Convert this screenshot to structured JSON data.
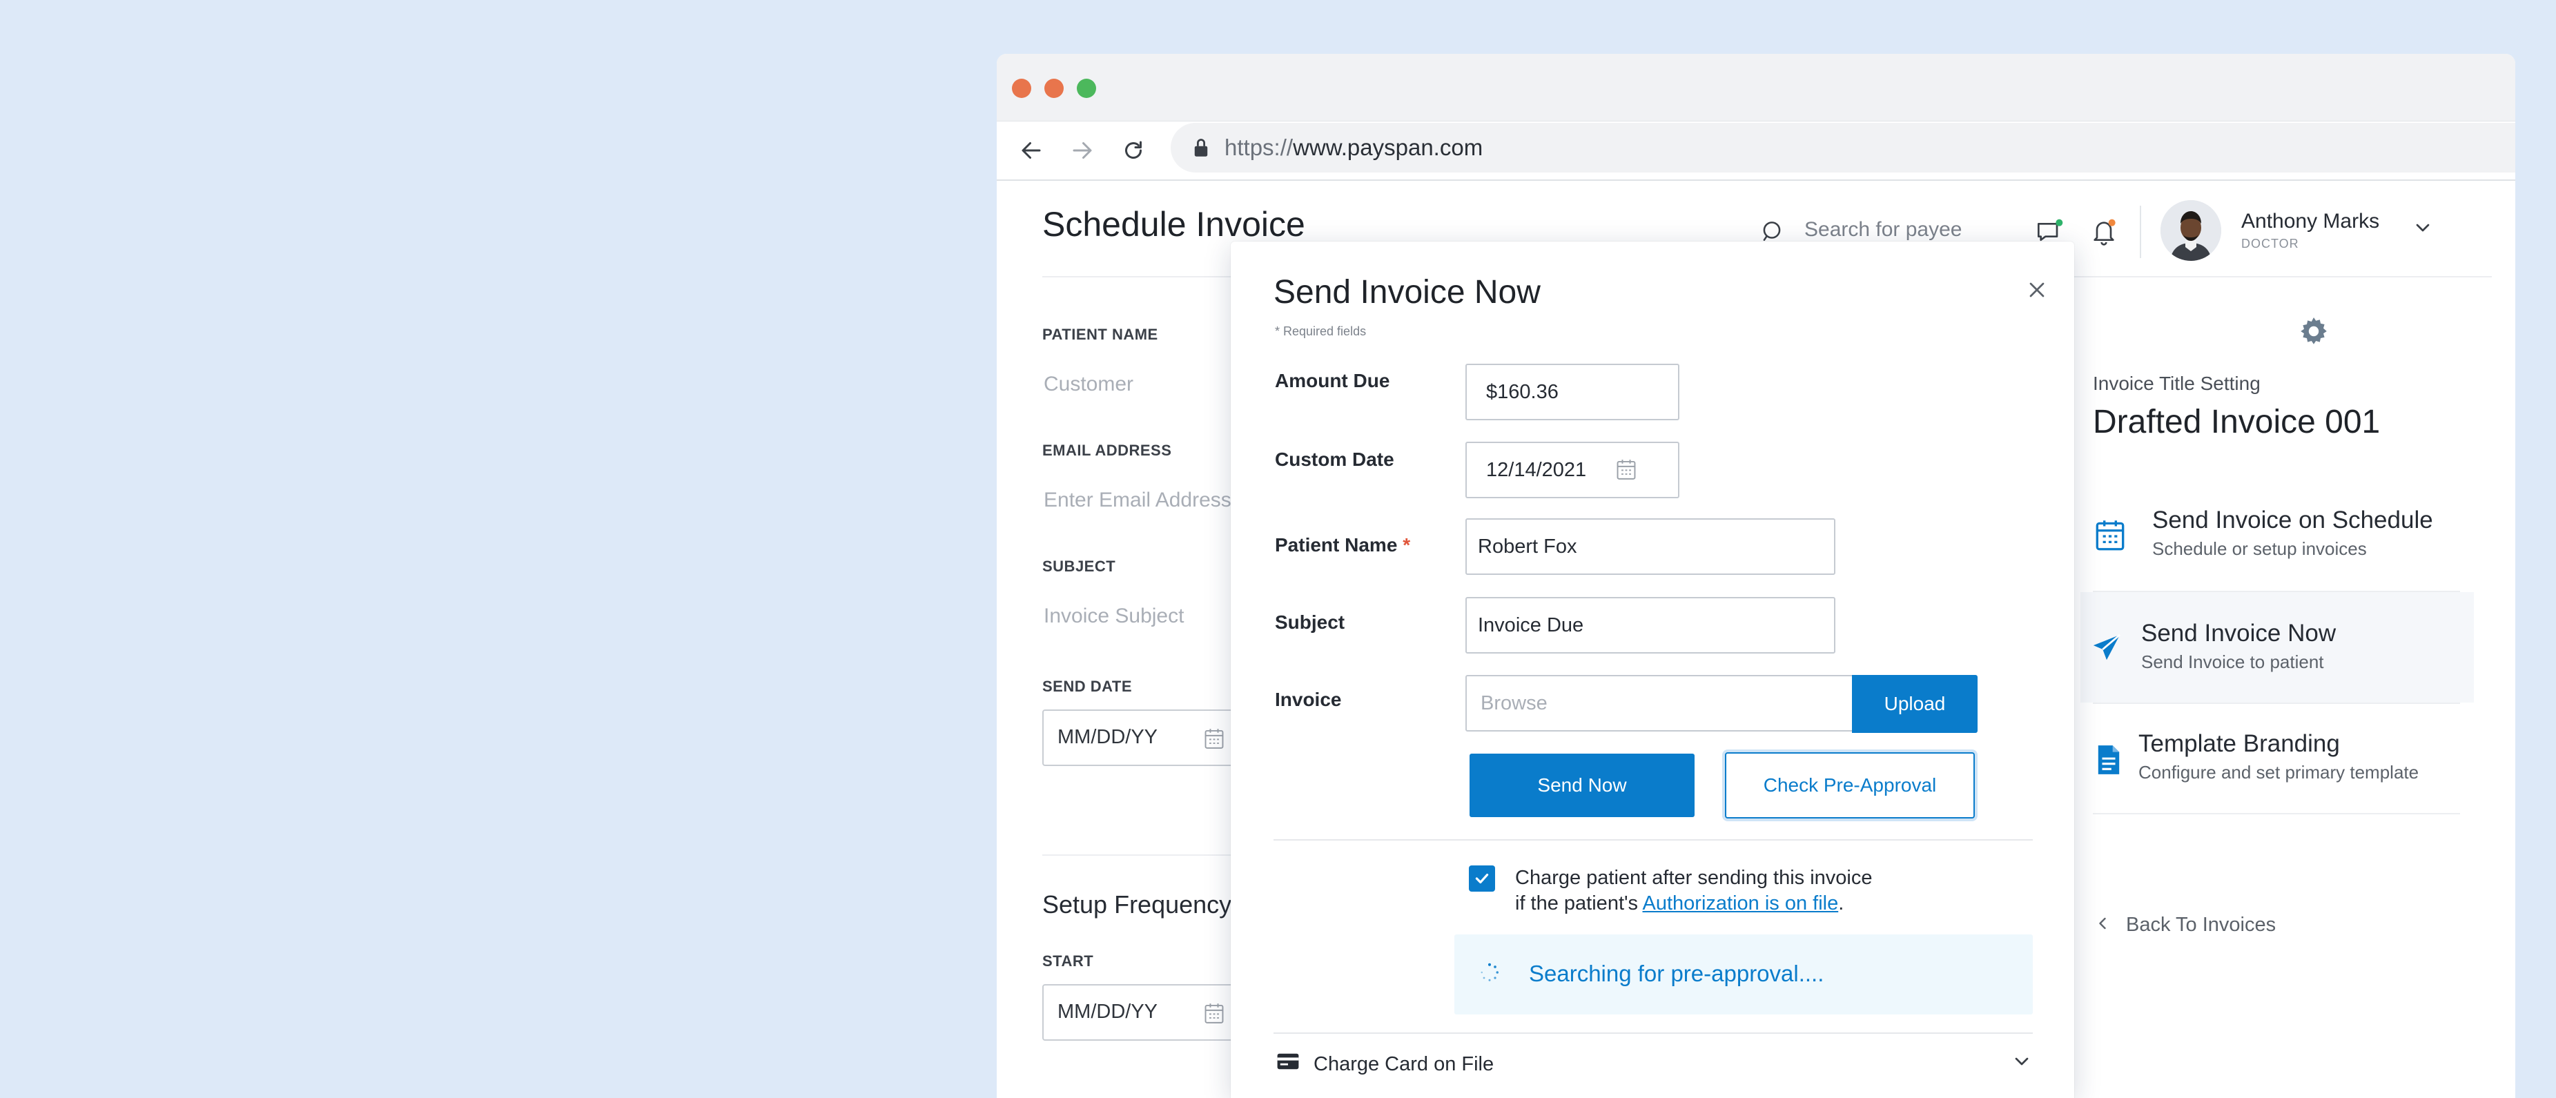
{
  "browser": {
    "url_scheme": "https://",
    "url_host": "www.payspan.com"
  },
  "page": {
    "title": "Schedule Invoice",
    "search_placeholder": "Search for payee",
    "user": {
      "name": "Anthony Marks",
      "role": "DOCTOR"
    },
    "form": {
      "patient_name_label": "PATIENT NAME",
      "patient_name_placeholder": "Customer",
      "email_label": "EMAIL ADDRESS",
      "email_placeholder": "Enter Email Address",
      "subject_label": "SUBJECT",
      "subject_placeholder": "Invoice Subject",
      "send_date_label": "SEND DATE",
      "send_date_placeholder": "MM/DD/YY",
      "setup_frequency_title": "Setup Frequency",
      "start_label": "START",
      "start_placeholder": "MM/DD/YY"
    }
  },
  "right_panel": {
    "setting_label": "Invoice Title Setting",
    "invoice_title": "Drafted Invoice 001",
    "menu": [
      {
        "title": "Send Invoice on Schedule",
        "subtitle": "Schedule or setup invoices",
        "icon": "calendar-icon",
        "active": false
      },
      {
        "title": "Send Invoice Now",
        "subtitle": "Send Invoice to patient",
        "icon": "paper-plane-icon",
        "active": true
      },
      {
        "title": "Template Branding",
        "subtitle": "Configure and set primary template",
        "icon": "document-icon",
        "active": false
      }
    ],
    "back_link": "Back To Invoices"
  },
  "modal": {
    "title": "Send Invoice Now",
    "required_note": "* Required fields",
    "fields": {
      "amount_due_label": "Amount Due",
      "amount_due_value": "$160.36",
      "custom_date_label": "Custom Date",
      "custom_date_value": "12/14/2021",
      "patient_name_label": "Patient Name",
      "patient_name_required": "*",
      "patient_name_value": "Robert Fox",
      "subject_label": "Subject",
      "subject_value": "Invoice Due",
      "invoice_label": "Invoice",
      "invoice_placeholder": "Browse"
    },
    "upload_label": "Upload",
    "send_now_label": "Send Now",
    "check_preapproval_label": "Check Pre-Approval",
    "charge_text_line1": "Charge patient after sending this invoice",
    "charge_text_line2_prefix": "if the patient's ",
    "charge_text_link": "Authorization is on file",
    "charge_text_suffix": ".",
    "charge_checked": true,
    "searching_text": "Searching for pre-approval....",
    "card_row_label": "Charge Card on File"
  },
  "colors": {
    "accent": "#0a7ccb",
    "background": "#dde9f8",
    "traffic_red": "#e8754c",
    "traffic_yellow": "#e8754c",
    "traffic_green": "#4cb85c",
    "notification_green": "#2fb36b",
    "notification_orange": "#f0883e"
  }
}
